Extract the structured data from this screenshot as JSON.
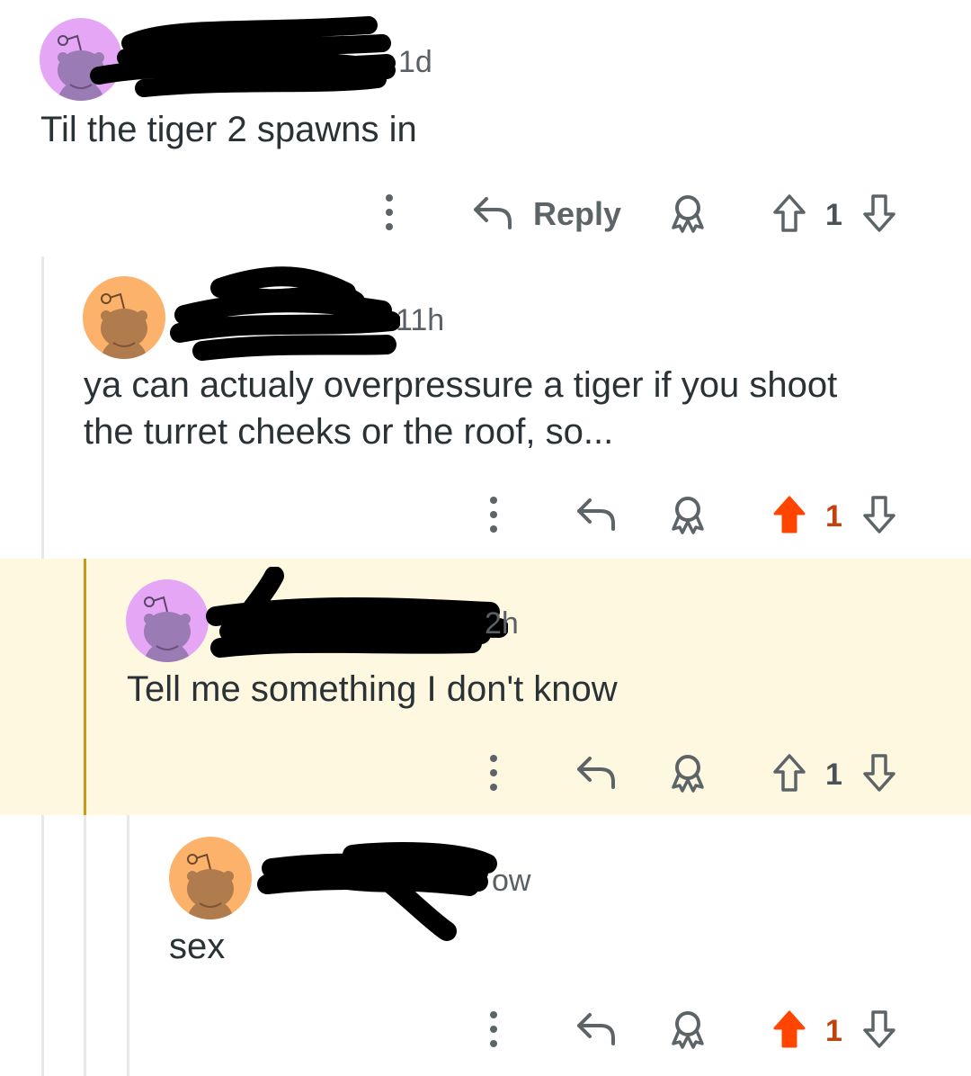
{
  "comments": [
    {
      "time": "1d",
      "text": "Til the tiger 2 spawns in",
      "reply_label": "Reply",
      "score": "1",
      "upvoted": false,
      "avatar_color": "#e4a6f5"
    },
    {
      "time": "11h",
      "text_line1": "ya can actualy overpressure a tiger if you shoot",
      "text_line2": "the turret cheeks or the roof, so...",
      "score": "1",
      "upvoted": true,
      "avatar_color": "#fcb26b"
    },
    {
      "time": "2h",
      "text": "Tell me something I don't know",
      "score": "1",
      "upvoted": false,
      "highlighted": true,
      "avatar_color": "#e4a6f5"
    },
    {
      "time": "ow",
      "text": "sex",
      "score": "1",
      "upvoted": true,
      "avatar_color": "#fcb26b"
    }
  ],
  "colors": {
    "upvote_active": "#ff4500",
    "highlight_bg": "#fff8e1",
    "highlight_bar": "#c69a1a",
    "thread_line": "#e6e8ea",
    "text": "#2a3236"
  },
  "icons": [
    "overflow-menu-icon",
    "reply-arrow-icon",
    "award-icon",
    "upvote-icon",
    "downvote-icon"
  ]
}
